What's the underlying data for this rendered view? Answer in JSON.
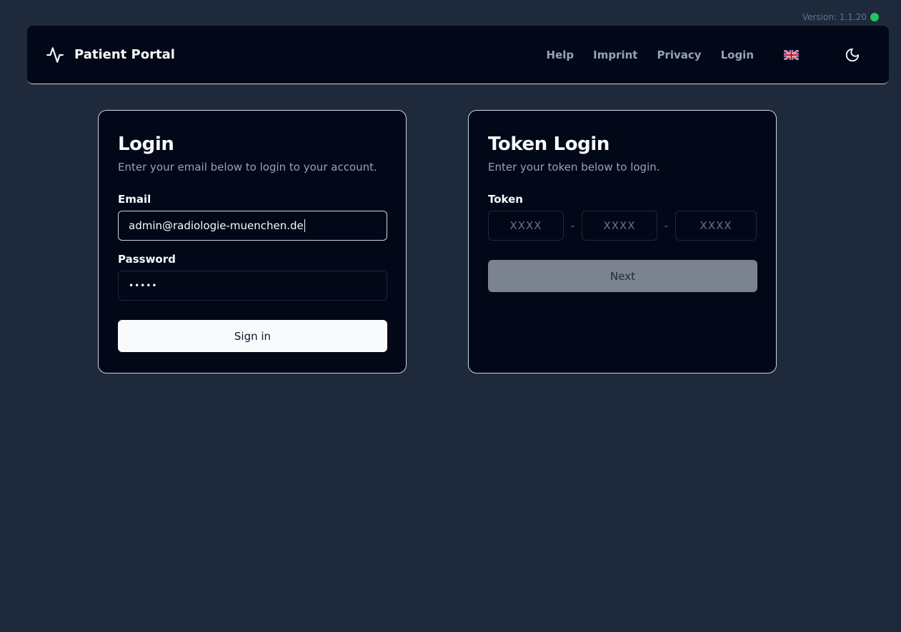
{
  "version": {
    "label": "Version: 1.1.20",
    "status_color": "#22c55e"
  },
  "header": {
    "brand": "Patient Portal",
    "brand_icon": "activity-pulse-icon",
    "nav": {
      "help": "Help",
      "imprint": "Imprint",
      "privacy": "Privacy",
      "login": "Login"
    },
    "language_icon": "uk-flag-icon",
    "theme_icon": "moon-icon"
  },
  "login_card": {
    "title": "Login",
    "description": "Enter your email below to login to your account.",
    "email_label": "Email",
    "email_value": "admin@radiologie-muenchen.de",
    "password_label": "Password",
    "password_value": "•••••",
    "submit_label": "Sign in"
  },
  "token_card": {
    "title": "Token Login",
    "description": "Enter your token below to login.",
    "token_label": "Token",
    "token_placeholders": [
      "XXXX",
      "XXXX",
      "XXXX"
    ],
    "separator": "-",
    "next_label": "Next"
  },
  "colors": {
    "background": "#1e293b",
    "card": "#020817",
    "accent_light": "#f8fafc",
    "muted_text": "#94a3b8",
    "disabled_button": "#7c8390"
  }
}
